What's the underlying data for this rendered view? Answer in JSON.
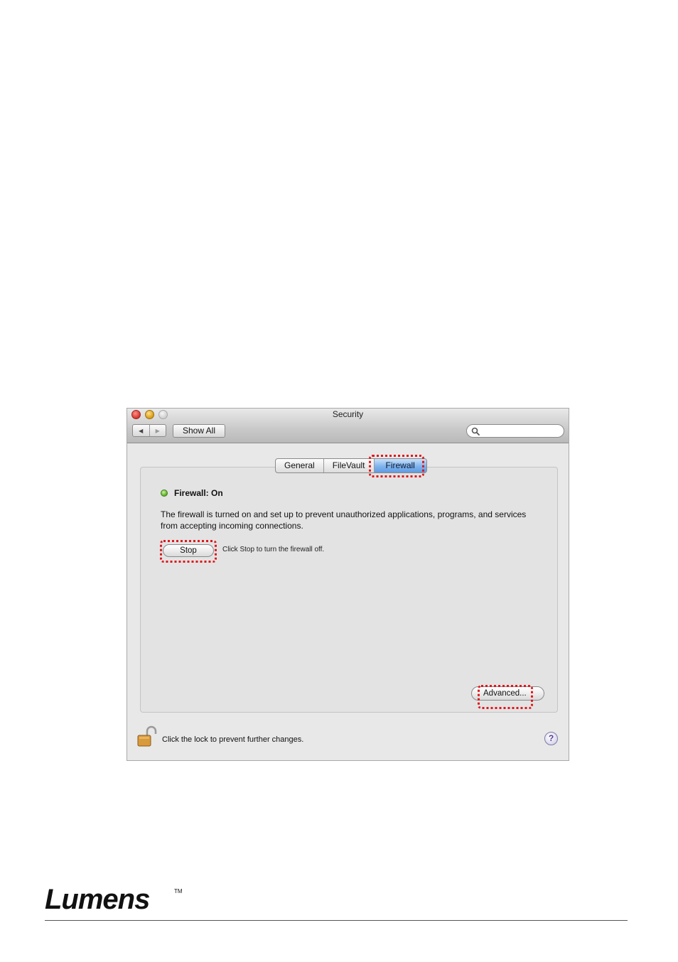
{
  "window": {
    "title": "Security"
  },
  "toolbar": {
    "back_icon": "back-arrow-icon",
    "forward_icon": "forward-arrow-icon",
    "show_all_label": "Show All",
    "search": {
      "value": "",
      "placeholder": ""
    }
  },
  "tabs": [
    {
      "label": "General",
      "selected": false
    },
    {
      "label": "FileVault",
      "selected": false
    },
    {
      "label": "Firewall",
      "selected": true
    }
  ],
  "firewall": {
    "status_label": "Firewall: On",
    "status_color": "#5aae25",
    "description": "The firewall is turned on and set up to prevent unauthorized applications, programs, and services from accepting incoming connections.",
    "stop_button_label": "Stop",
    "stop_hint": "Click Stop to turn the firewall off.",
    "advanced_button_label": "Advanced..."
  },
  "bottom_bar": {
    "lock_icon": "unlocked-padlock-icon",
    "lock_text": "Click the lock to prevent further changes.",
    "help_label": "?"
  },
  "annotations": {
    "highlight_color": "#e0161b",
    "highlighted": [
      "Firewall",
      "Stop",
      "Advanced..."
    ]
  },
  "footer": {
    "logo_text": "Lumens",
    "trademark": "TM"
  }
}
